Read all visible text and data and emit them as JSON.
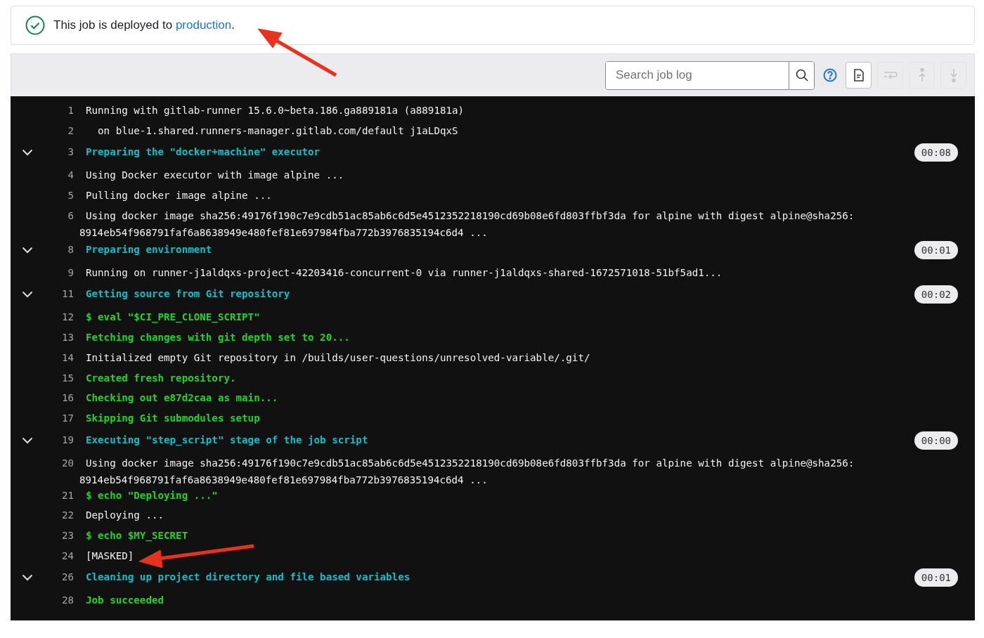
{
  "banner": {
    "prefix": "This job is deployed to ",
    "link": "production",
    "suffix": "."
  },
  "toolbar": {
    "search": {
      "placeholder": "Search job log"
    },
    "buttons": [
      {
        "kind": "raw",
        "disabled": false
      },
      {
        "kind": "wrap",
        "disabled": true
      },
      {
        "kind": "top",
        "disabled": true
      },
      {
        "kind": "bottom",
        "disabled": true
      }
    ]
  },
  "log": [
    {
      "number": "1",
      "kind": "plain",
      "text": "Running with gitlab-runner 15.6.0~beta.186.ga889181a (a889181a)"
    },
    {
      "number": "2",
      "kind": "plain",
      "text": "  on blue-1.shared.runners-manager.gitlab.com/default j1aLDqxS"
    },
    {
      "number": "3",
      "kind": "section",
      "text": "Preparing the \"docker+machine\" executor",
      "expanded": true,
      "duration": "00:08"
    },
    {
      "number": "4",
      "kind": "plain",
      "text": "Using Docker executor with image alpine ..."
    },
    {
      "number": "5",
      "kind": "plain",
      "text": "Pulling docker image alpine ..."
    },
    {
      "number": "6",
      "kind": "plain",
      "text": "Using docker image sha256:49176f190c7e9cdb51ac85ab6c6d5e4512352218190cd69b08e6fd803ffbf3da for alpine with digest alpine@sha256:",
      "continuation": "8914eb54f968791faf6a8638949e480fef81e697984fba772b3976835194c6d4 ..."
    },
    {
      "number": "8",
      "kind": "section",
      "text": "Preparing environment",
      "expanded": true,
      "duration": "00:01"
    },
    {
      "number": "9",
      "kind": "plain",
      "text": "Running on runner-j1aldqxs-project-42203416-concurrent-0 via runner-j1aldqxs-shared-1672571018-51bf5ad1..."
    },
    {
      "number": "11",
      "kind": "section",
      "text": "Getting source from Git repository",
      "expanded": true,
      "duration": "00:02"
    },
    {
      "number": "12",
      "kind": "command",
      "text": "$ eval \"$CI_PRE_CLONE_SCRIPT\""
    },
    {
      "number": "13",
      "kind": "command",
      "text": "Fetching changes with git depth set to 20..."
    },
    {
      "number": "14",
      "kind": "plain",
      "text": "Initialized empty Git repository in /builds/user-questions/unresolved-variable/.git/"
    },
    {
      "number": "15",
      "kind": "command",
      "text": "Created fresh repository."
    },
    {
      "number": "16",
      "kind": "command",
      "text": "Checking out e87d2caa as main..."
    },
    {
      "number": "17",
      "kind": "command",
      "text": "Skipping Git submodules setup"
    },
    {
      "number": "19",
      "kind": "section",
      "text": "Executing \"step_script\" stage of the job script",
      "expanded": true,
      "duration": "00:00"
    },
    {
      "number": "20",
      "kind": "plain",
      "text": "Using docker image sha256:49176f190c7e9cdb51ac85ab6c6d5e4512352218190cd69b08e6fd803ffbf3da for alpine with digest alpine@sha256:",
      "continuation": "8914eb54f968791faf6a8638949e480fef81e697984fba772b3976835194c6d4 ..."
    },
    {
      "number": "21",
      "kind": "command",
      "text": "$ echo \"Deploying ...\""
    },
    {
      "number": "22",
      "kind": "plain",
      "text": "Deploying ..."
    },
    {
      "number": "23",
      "kind": "command",
      "text": "$ echo $MY_SECRET"
    },
    {
      "number": "24",
      "kind": "plain",
      "text": "[MASKED]"
    },
    {
      "number": "26",
      "kind": "section",
      "text": "Cleaning up project directory and file based variables",
      "expanded": true,
      "duration": "00:01"
    },
    {
      "number": "28",
      "kind": "command",
      "text": "Job succeeded"
    }
  ]
}
